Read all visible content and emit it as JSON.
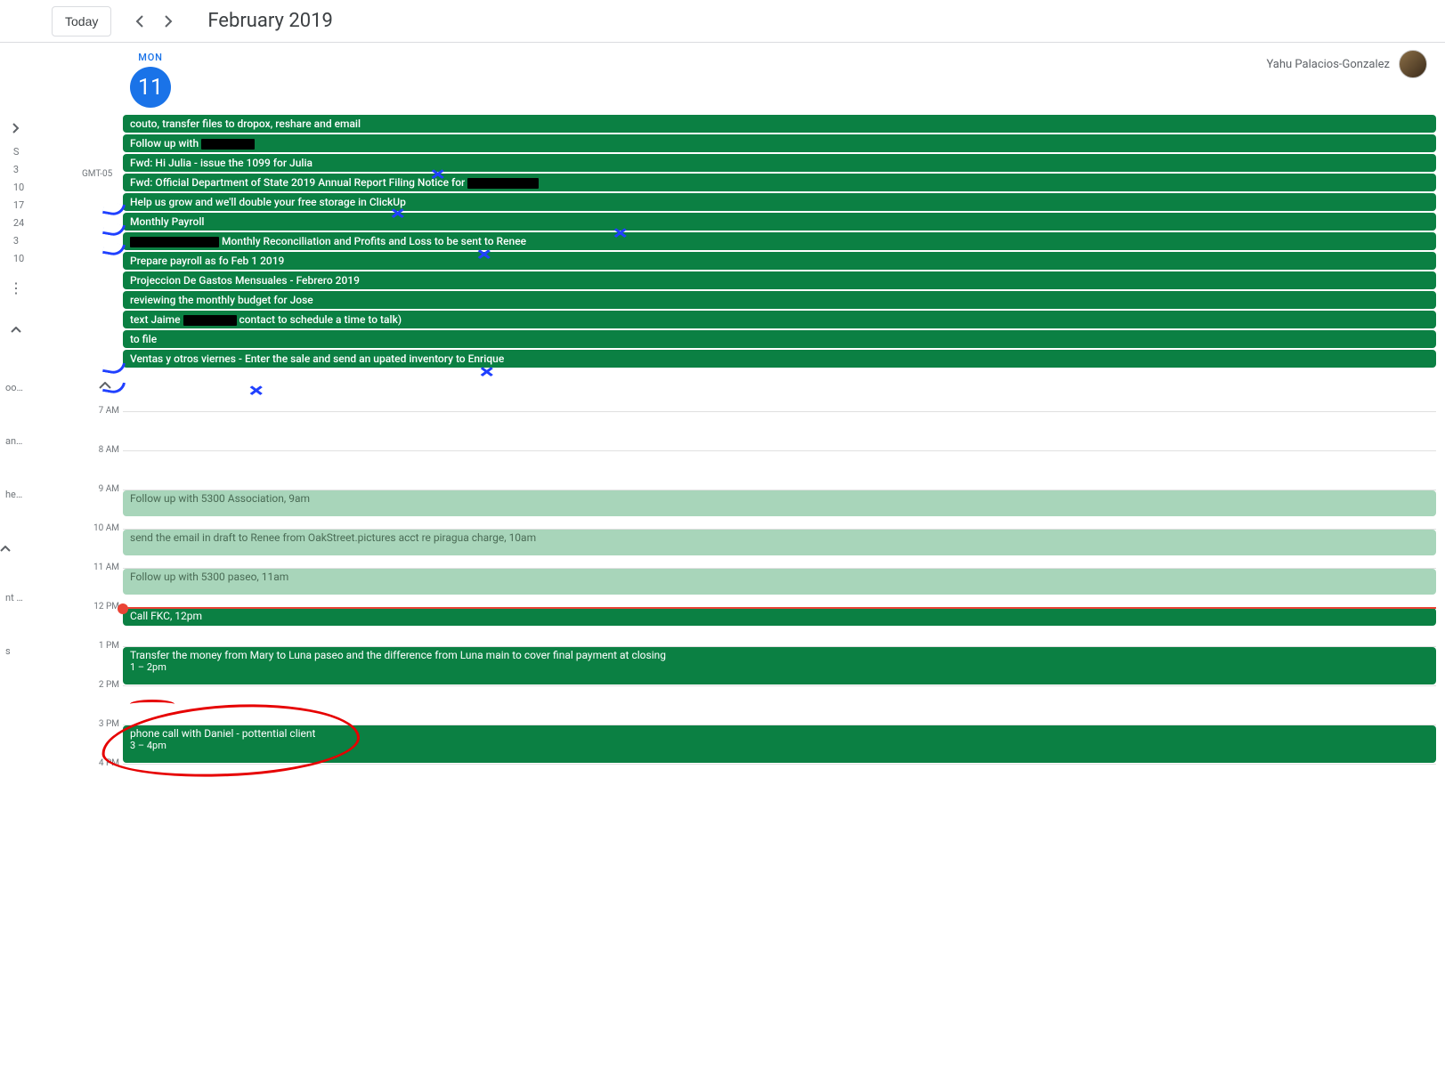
{
  "header": {
    "today_label": "Today",
    "title": "February 2019"
  },
  "day": {
    "name": "MON",
    "num": "11",
    "tz": "GMT-05"
  },
  "user": {
    "name": "Yahu Palacios-Gonzalez"
  },
  "sidebar": {
    "rows": [
      "S",
      "3",
      "10",
      "17",
      "24",
      "3",
      "10"
    ],
    "lower": [
      "oo…",
      "an…",
      "he…",
      "nt …",
      "s"
    ]
  },
  "allday": [
    {
      "pre": "couto, transfer files to dropox, reshare and email",
      "redact": "",
      "post": ""
    },
    {
      "pre": "Follow up with ",
      "redact": "w60",
      "post": ""
    },
    {
      "pre": "Fwd: Hi Julia - issue the 1099 for Julia",
      "redact": "",
      "post": ""
    },
    {
      "pre": "Fwd: Official Department of State 2019 Annual Report Filing Notice for ",
      "redact": "w80",
      "post": ""
    },
    {
      "pre": "Help us grow and we'll double your free storage in ClickUp",
      "redact": "",
      "post": ""
    },
    {
      "pre": "Monthly Payroll",
      "redact": "",
      "post": ""
    },
    {
      "pre": "",
      "redact": "w100",
      "post": " Monthly Reconciliation and Profits and Loss to be sent to Renee"
    },
    {
      "pre": "Prepare payroll as fo Feb 1 2019",
      "redact": "",
      "post": ""
    },
    {
      "pre": "Projeccion De Gastos Mensuales - Febrero 2019",
      "redact": "",
      "post": ""
    },
    {
      "pre": "reviewing the monthly budget for Jose",
      "redact": "",
      "post": ""
    },
    {
      "pre": "text Jaime ",
      "redact": "w60",
      "post": " contact to schedule a time to talk)"
    },
    {
      "pre": "to file",
      "redact": "",
      "post": ""
    },
    {
      "pre": "Ventas y otros viernes - Enter the sale and send an upated inventory to Enrique",
      "redact": "",
      "post": ""
    }
  ],
  "hours": [
    "7 AM",
    "8 AM",
    "9 AM",
    "10 AM",
    "11 AM",
    "12 PM",
    "1 PM",
    "2 PM",
    "3 PM",
    "4 PM"
  ],
  "timed": [
    {
      "title": "Follow up with 5300 Association, ",
      "time": "9am",
      "cls": "ev-light",
      "topHour": 2,
      "heightHours": 0.7
    },
    {
      "title": "send the email in draft to Renee from OakStreet.pictures acct re piragua charge, ",
      "time": "10am",
      "cls": "ev-light",
      "topHour": 3,
      "heightHours": 0.7
    },
    {
      "title": "Follow up with 5300 paseo, ",
      "time": "11am",
      "cls": "ev-light",
      "topHour": 4,
      "heightHours": 0.7
    },
    {
      "title": "Call FKC, ",
      "time": "12pm",
      "cls": "ev-green",
      "topHour": 5,
      "heightHours": 0.5
    },
    {
      "title": "Transfer the money from Mary to Luna paseo and the difference from Luna main to cover final payment at closing",
      "time": "",
      "sub": "1 – 2pm",
      "cls": "ev-green",
      "topHour": 6,
      "heightHours": 1
    },
    {
      "title": "phone call with Daniel - pottential client",
      "time": "",
      "sub": "3 – 4pm",
      "cls": "ev-green",
      "topHour": 8,
      "heightHours": 1
    }
  ],
  "nowHour": 5
}
